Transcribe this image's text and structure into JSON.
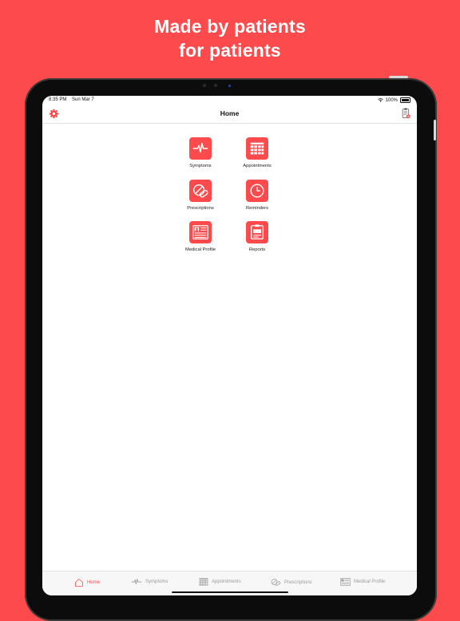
{
  "marketing": {
    "headline_line1": "Made by patients",
    "headline_line2": "for patients"
  },
  "status_bar": {
    "time": "8:35 PM",
    "date": "Sun Mar 7",
    "battery_percent": "100%"
  },
  "nav": {
    "title": "Home",
    "left_icon": "gear-icon",
    "right_icon": "report-clipboard-icon"
  },
  "tiles": [
    {
      "label": "Symptoms",
      "icon": "pulse-icon"
    },
    {
      "label": "Appointments",
      "icon": "calendar-grid-icon"
    },
    {
      "label": "Prescriptions",
      "icon": "pills-icon"
    },
    {
      "label": "Reminders",
      "icon": "clock-icon"
    },
    {
      "label": "Medical Profile",
      "icon": "profile-card-icon"
    },
    {
      "label": "Reports",
      "icon": "report-icon"
    }
  ],
  "tab_bar": {
    "items": [
      {
        "label": "Home",
        "icon": "home-icon",
        "active": true
      },
      {
        "label": "Symptoms",
        "icon": "pulse-icon",
        "active": false
      },
      {
        "label": "Appointments",
        "icon": "calendar-grid-icon",
        "active": false
      },
      {
        "label": "Prescriptions",
        "icon": "pills-icon",
        "active": false
      },
      {
        "label": "Medical Profile",
        "icon": "profile-card-icon",
        "active": false
      }
    ]
  },
  "colors": {
    "accent": "#fd4a4c",
    "inactive_tab": "#9a9a9a"
  }
}
